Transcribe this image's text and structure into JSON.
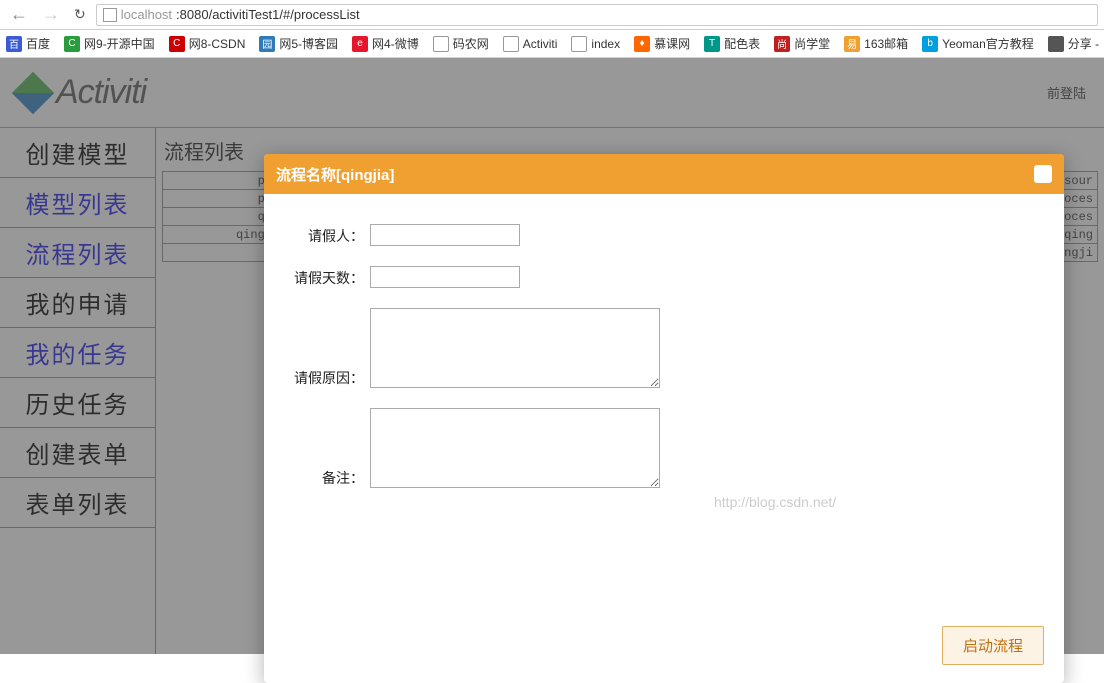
{
  "browser": {
    "url_host": "localhost",
    "url_path": ":8080/activitiTest1/#/processList",
    "bookmarks": [
      {
        "label": "百度",
        "icon": "ic-baidu",
        "glyph": "百"
      },
      {
        "label": "网9-开源中国",
        "icon": "ic-oschina",
        "glyph": "C"
      },
      {
        "label": "网8-CSDN",
        "icon": "ic-csdn",
        "glyph": "C"
      },
      {
        "label": "网5-博客园",
        "icon": "ic-boke",
        "glyph": "园"
      },
      {
        "label": "网4-微博",
        "icon": "ic-weibo",
        "glyph": "e"
      },
      {
        "label": "码农网",
        "icon": "ic-page",
        "glyph": ""
      },
      {
        "label": "Activiti",
        "icon": "ic-activiti",
        "glyph": ""
      },
      {
        "label": "index",
        "icon": "ic-page",
        "glyph": ""
      },
      {
        "label": "慕课网",
        "icon": "ic-imooc",
        "glyph": "♦"
      },
      {
        "label": "配色表",
        "icon": "ic-peise",
        "glyph": "T"
      },
      {
        "label": "尚学堂",
        "icon": "ic-sxt",
        "glyph": "尚"
      },
      {
        "label": "163邮箱",
        "icon": "ic-163",
        "glyph": "易"
      },
      {
        "label": "Yeoman官方教程",
        "icon": "ic-yeoman",
        "glyph": "b"
      },
      {
        "label": "分享 -",
        "icon": "ic-share",
        "glyph": ""
      }
    ]
  },
  "header": {
    "logo_text": "Activiti",
    "login_info": "前登陆"
  },
  "sidebar": {
    "items": [
      {
        "label": "创建模型",
        "link": false
      },
      {
        "label": "模型列表",
        "link": true
      },
      {
        "label": "流程列表",
        "link": true
      },
      {
        "label": "我的申请",
        "link": false
      },
      {
        "label": "我的任务",
        "link": true
      },
      {
        "label": "历史任务",
        "link": false
      },
      {
        "label": "创建表单",
        "link": false
      },
      {
        "label": "表单列表",
        "link": false
      }
    ]
  },
  "content": {
    "title": "流程列表",
    "rows": [
      {
        "c1": "process",
        "c2": "Resour"
      },
      {
        "c1": "process",
        "c2": "proces"
      },
      {
        "c1": "qingjia",
        "c2": "proces"
      },
      {
        "c1": "qingjiaces",
        "c2": ".qing"
      },
      {
        "c1": "",
        "c2": "ingji"
      }
    ]
  },
  "dialog": {
    "title": "流程名称[qingjia]",
    "fields": {
      "applicant_label": "请假人：",
      "days_label": "请假天数：",
      "reason_label": "请假原因：",
      "remark_label": "备注："
    },
    "submit_label": "启动流程",
    "watermark": "http://blog.csdn.net/"
  }
}
